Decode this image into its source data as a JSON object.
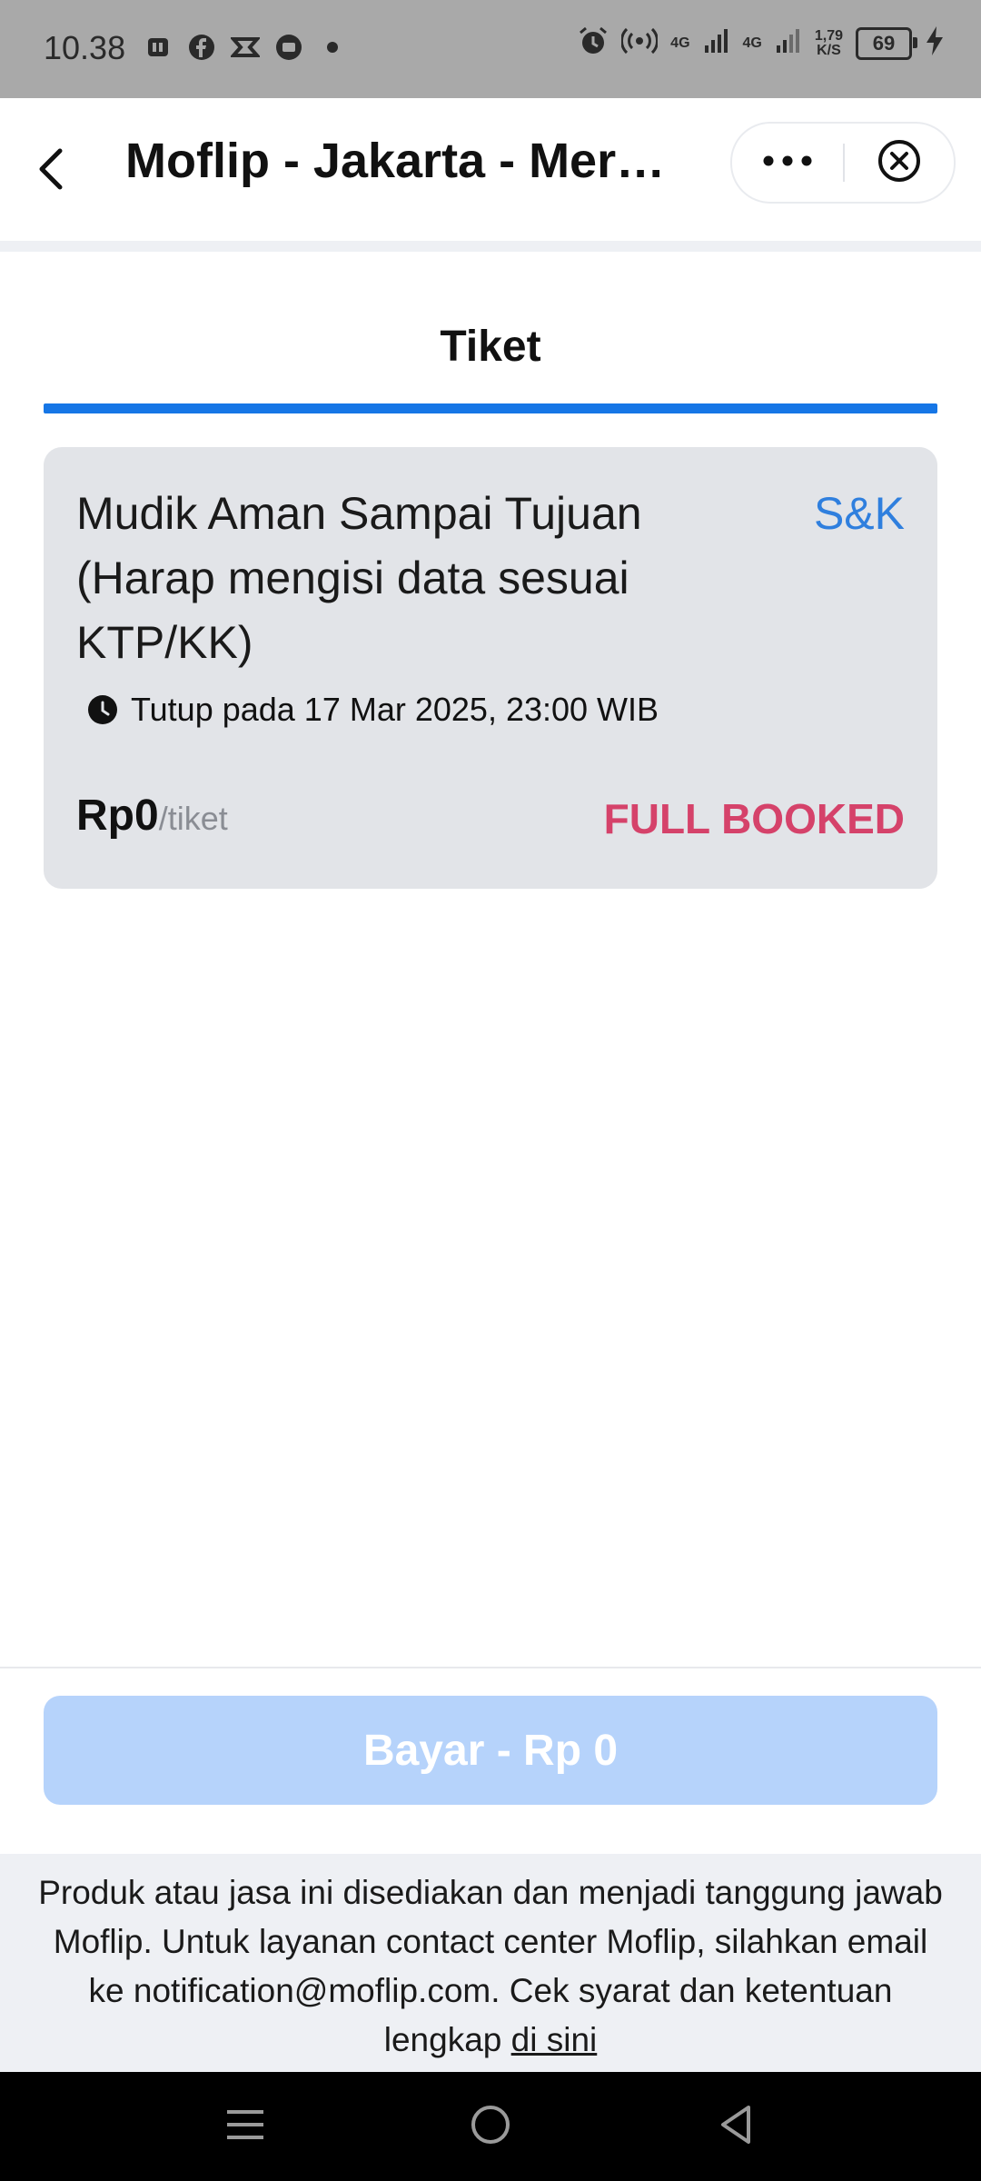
{
  "status_bar": {
    "time": "10.38",
    "network1": "4G",
    "network2": "4G",
    "speed_value": "1,79",
    "speed_unit": "K/S",
    "battery": "69"
  },
  "header": {
    "title": "Moflip - Jakarta - Merak...",
    "more_icon": "more-dots-icon",
    "close_icon": "close-circle-icon",
    "back_icon": "chevron-left-icon"
  },
  "tabs": [
    {
      "label": "Tiket",
      "active": true
    }
  ],
  "ticket": {
    "title": "Mudik Aman Sampai Tujuan (Harap mengisi data sesuai KTP/KK)",
    "terms_link": "S&K",
    "close_info": "Tutup pada 17 Mar 2025, 23:00 WIB",
    "price": "Rp0",
    "per_unit": "/tiket",
    "status": "FULL BOOKED"
  },
  "pay_button": {
    "label": "Bayar - Rp 0",
    "disabled": true
  },
  "footer": {
    "text": "Produk atau jasa ini disediakan dan menjadi tanggung jawab Moflip. Untuk layanan contact center Moflip, silahkan email ke notification@moflip.com. Cek syarat dan ketentuan lengkap",
    "link": "di sini"
  },
  "colors": {
    "accent": "#1676e6",
    "status_full": "#d5426a",
    "link": "#2f7fde",
    "pay_disabled": "#b6d3fb"
  }
}
